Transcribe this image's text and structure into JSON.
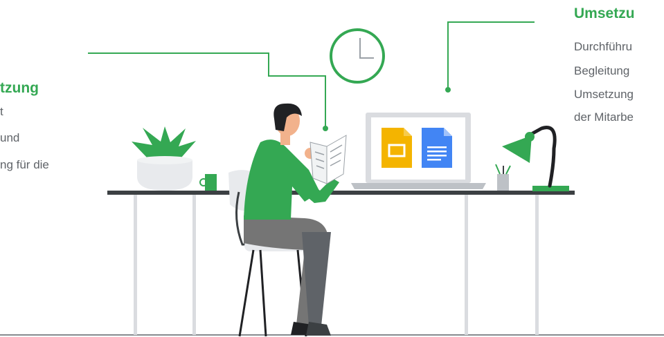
{
  "left_caption": {
    "title": "tzung",
    "lines": [
      "t",
      "und",
      "ng für die"
    ]
  },
  "right_caption": {
    "title": "Umsetzu",
    "lines": [
      "Durchführu",
      "Begleitung",
      "Umsetzung",
      "der Mitarbe"
    ]
  },
  "icons": {
    "slides": "google-slides-icon",
    "docs": "google-docs-icon",
    "clock": "clock-icon"
  },
  "colors": {
    "accent_green": "#34A853",
    "slides_yellow": "#F4B400",
    "docs_blue": "#4285F4",
    "text_gray": "#5f6368"
  }
}
